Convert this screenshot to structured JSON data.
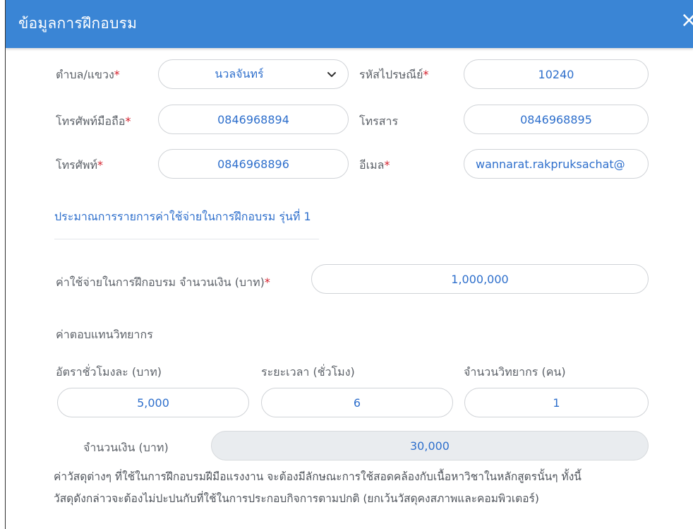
{
  "header": {
    "title": "ข้อมูลการฝึกอบรม",
    "close_glyph": "×"
  },
  "address": {
    "subdistrict": {
      "label": "ตำบล/แขวง",
      "required": "*",
      "value": "นวลจันทร์"
    },
    "postcode": {
      "label": "รหัสไปรษณีย์",
      "required": "*",
      "value": "10240"
    },
    "mobile": {
      "label": "โทรศัพท์มือถือ",
      "required": "*",
      "value": "0846968894"
    },
    "fax": {
      "label": "โทรสาร",
      "value": "0846968895"
    },
    "phone": {
      "label": "โทรศัพท์",
      "required": "*",
      "value": "0846968896"
    },
    "email": {
      "label": "อีเมล",
      "required": "*",
      "value": "wannarat.rakpruksachat@"
    }
  },
  "estimate": {
    "title": "ประมาณการรายการค่าใช้จ่ายในการฝึกอบรม รุ่นที่ 1",
    "total_cost": {
      "label": "ค่าใช้จ่ายในการฝึกอบรม จำนวนเงิน (บาท)",
      "required": "*",
      "value": "1,000,000"
    }
  },
  "lecturer_fee": {
    "title": "ค่าตอบแทนวิทยากร",
    "hourly_rate": {
      "label": "อัตราชั่วโมงละ (บาท)",
      "value": "5,000"
    },
    "duration": {
      "label": "ระยะเวลา (ชั่วโมง)",
      "value": "6"
    },
    "lecturer_count": {
      "label": "จำนวนวิทยากร (คน)",
      "value": "1"
    },
    "amount": {
      "label": "จำนวนเงิน (บาท)",
      "value": "30,000"
    }
  },
  "materials_note": {
    "line1": "ค่าวัสดุต่างๆ ที่ใช้ในการฝึกอบรมฝีมือแรงงาน จะต้องมีลักษณะการใช้สอดคล้องกับเนื้อหาวิชาในหลักสูตรนั้นๆ ทั้งนี้",
    "line2": "วัสดุดังกล่าวจะต้องไม่ปะปนกับที่ใช้ในการประกอบกิจการตามปกติ (ยกเว้นวัสดุคงสภาพและคอมพิวเตอร์)"
  },
  "colors": {
    "header": "#3a85d5",
    "value_text": "#2e6fcc",
    "required": "#d41f2b"
  },
  "icons": {
    "close": "close-icon",
    "dropdown": "chevron-down-icon"
  }
}
